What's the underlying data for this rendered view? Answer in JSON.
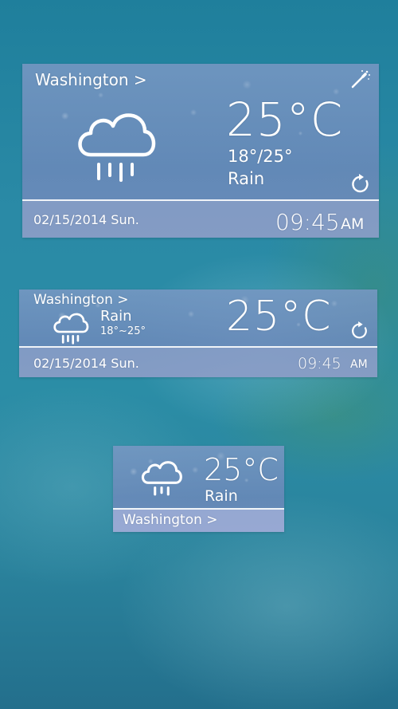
{
  "large_widget": {
    "city": "Washington >",
    "temperature": "25°C",
    "range": "18°/25°",
    "condition": "Rain",
    "date": "02/15/2014 Sun.",
    "time": "09:45",
    "ampm": "AM"
  },
  "medium_widget": {
    "city": "Washington >",
    "condition": "Rain",
    "range": "18°~25°",
    "temperature": "25°C",
    "date": "02/15/2014 Sun.",
    "time": "09:45",
    "ampm": "AM"
  },
  "small_widget": {
    "temperature": "25°C",
    "condition": "Rain",
    "city": "Washington >"
  },
  "icons": {
    "weather": "rain-cloud-icon",
    "refresh": "refresh-icon",
    "settings": "magic-wand-icon"
  },
  "colors": {
    "widget_tint": "#7a98c4",
    "text": "#ffffff",
    "background": "#2a8aa6"
  }
}
